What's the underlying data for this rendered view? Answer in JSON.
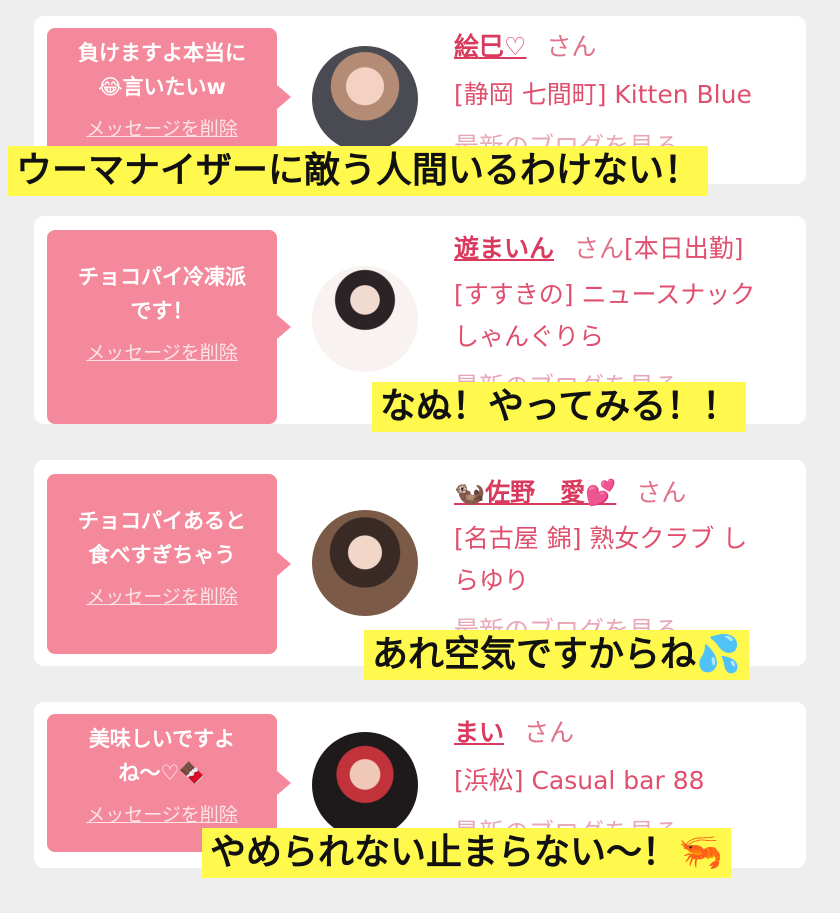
{
  "delete_label": "メッセージを削除",
  "honorific": "さん",
  "cards": [
    {
      "message_line1": "負けますよ本当に",
      "message_line2": "😂言いたいw",
      "name": "絵巳♡",
      "info_line1": "[静岡 七間町] Kitten Blue",
      "info_line2": "",
      "blog_partial": "最新のブログを見る"
    },
    {
      "message_line1": "チョコパイ冷凍派",
      "message_line2": "です！",
      "name": "遊まいん",
      "info_line1": "[本日出勤]",
      "info_line2": "[すすきの] ニュースナック",
      "info_line3": "しゃんぐりら",
      "blog_partial": "最新のブログを見る"
    },
    {
      "message_line1": "チョコパイあると",
      "message_line2": "食べすぎちゃう",
      "name": "🦦佐野　愛💕",
      "info_line1": "[名古屋 錦] 熟女クラブ し",
      "info_line2": "らゆり",
      "blog_partial": "最新のブログを見る"
    },
    {
      "message_line1": "美味しいですよ",
      "message_line2": "ね〜♡🍫",
      "name": "まい",
      "info_line1": "[浜松] Casual bar 88",
      "info_line2": "",
      "blog_partial": "最新のブログを見る"
    }
  ],
  "captions": [
    "ウーマナイザーに敵う人間いるわけない！",
    "なぬ！やってみる！！",
    "あれ空気ですからね💦",
    "やめられない止まらない〜！🦐"
  ],
  "colors": {
    "bubble": "#f4899b",
    "link": "#d93a5e",
    "caption_bg": "#fff94d"
  }
}
